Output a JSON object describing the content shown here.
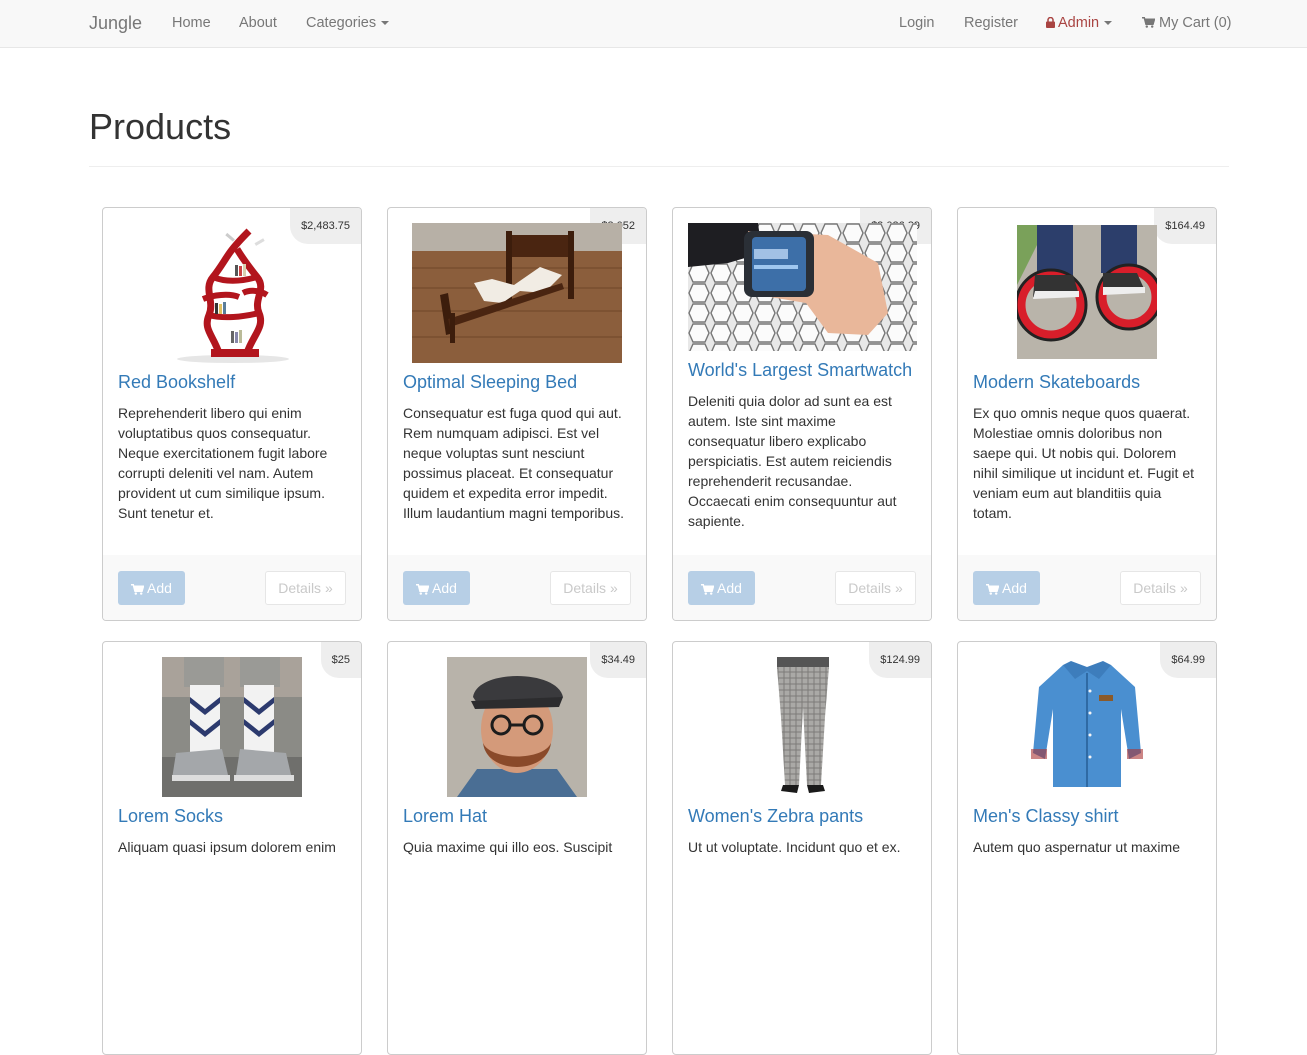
{
  "nav": {
    "brand": "Jungle",
    "home": "Home",
    "about": "About",
    "categories": "Categories",
    "login": "Login",
    "register": "Register",
    "admin": "Admin",
    "cart": "My Cart (0)"
  },
  "page": {
    "title": "Products"
  },
  "colors": {
    "link": "#337ab7",
    "admin": "#a94442",
    "add_button": "#b7cfe6"
  },
  "products": [
    {
      "name": "Red Bookshelf",
      "price": "$2,483.75",
      "description": "Reprehenderit libero qui enim voluptatibus quos consequatur. Neque exercitationem fugit labore corrupti deleniti vel nam. Autem provident ut cum similique ipsum. Sunt tenetur et.",
      "add_label": "Add",
      "details_label": "Details »"
    },
    {
      "name": "Optimal Sleeping Bed",
      "price": "$3,052",
      "description": "Consequatur est fuga quod qui aut. Rem numquam adipisci. Est vel neque voluptas sunt nesciunt possimus placeat. Et consequatur quidem et expedita error impedit. Illum laudantium magni temporibus.",
      "add_label": "Add",
      "details_label": "Details »"
    },
    {
      "name": "World's Largest Smartwatch",
      "price": "$2,026.29",
      "description": "Deleniti quia dolor ad sunt ea est autem. Iste sint maxime consequatur libero explicabo perspiciatis. Est autem reiciendis reprehenderit recusandae. Occaecati enim consequuntur aut sapiente.",
      "add_label": "Add",
      "details_label": "Details »"
    },
    {
      "name": "Modern Skateboards",
      "price": "$164.49",
      "description": "Ex quo omnis neque quos quaerat. Molestiae omnis doloribus non saepe qui. Ut nobis qui. Dolorem nihil similique ut incidunt et. Fugit et veniam eum aut blanditiis quia totam.",
      "add_label": "Add",
      "details_label": "Details »"
    },
    {
      "name": "Lorem Socks",
      "price": "$25",
      "description": "Aliquam quasi ipsum dolorem enim",
      "add_label": "Add",
      "details_label": "Details »"
    },
    {
      "name": "Lorem Hat",
      "price": "$34.49",
      "description": "Quia maxime qui illo eos. Suscipit",
      "add_label": "Add",
      "details_label": "Details »"
    },
    {
      "name": "Women's Zebra pants",
      "price": "$124.99",
      "description": "Ut ut voluptate. Incidunt quo et ex.",
      "add_label": "Add",
      "details_label": "Details »"
    },
    {
      "name": "Men's Classy shirt",
      "price": "$64.99",
      "description": "Autem quo aspernatur ut maxime",
      "add_label": "Add",
      "details_label": "Details »"
    }
  ]
}
